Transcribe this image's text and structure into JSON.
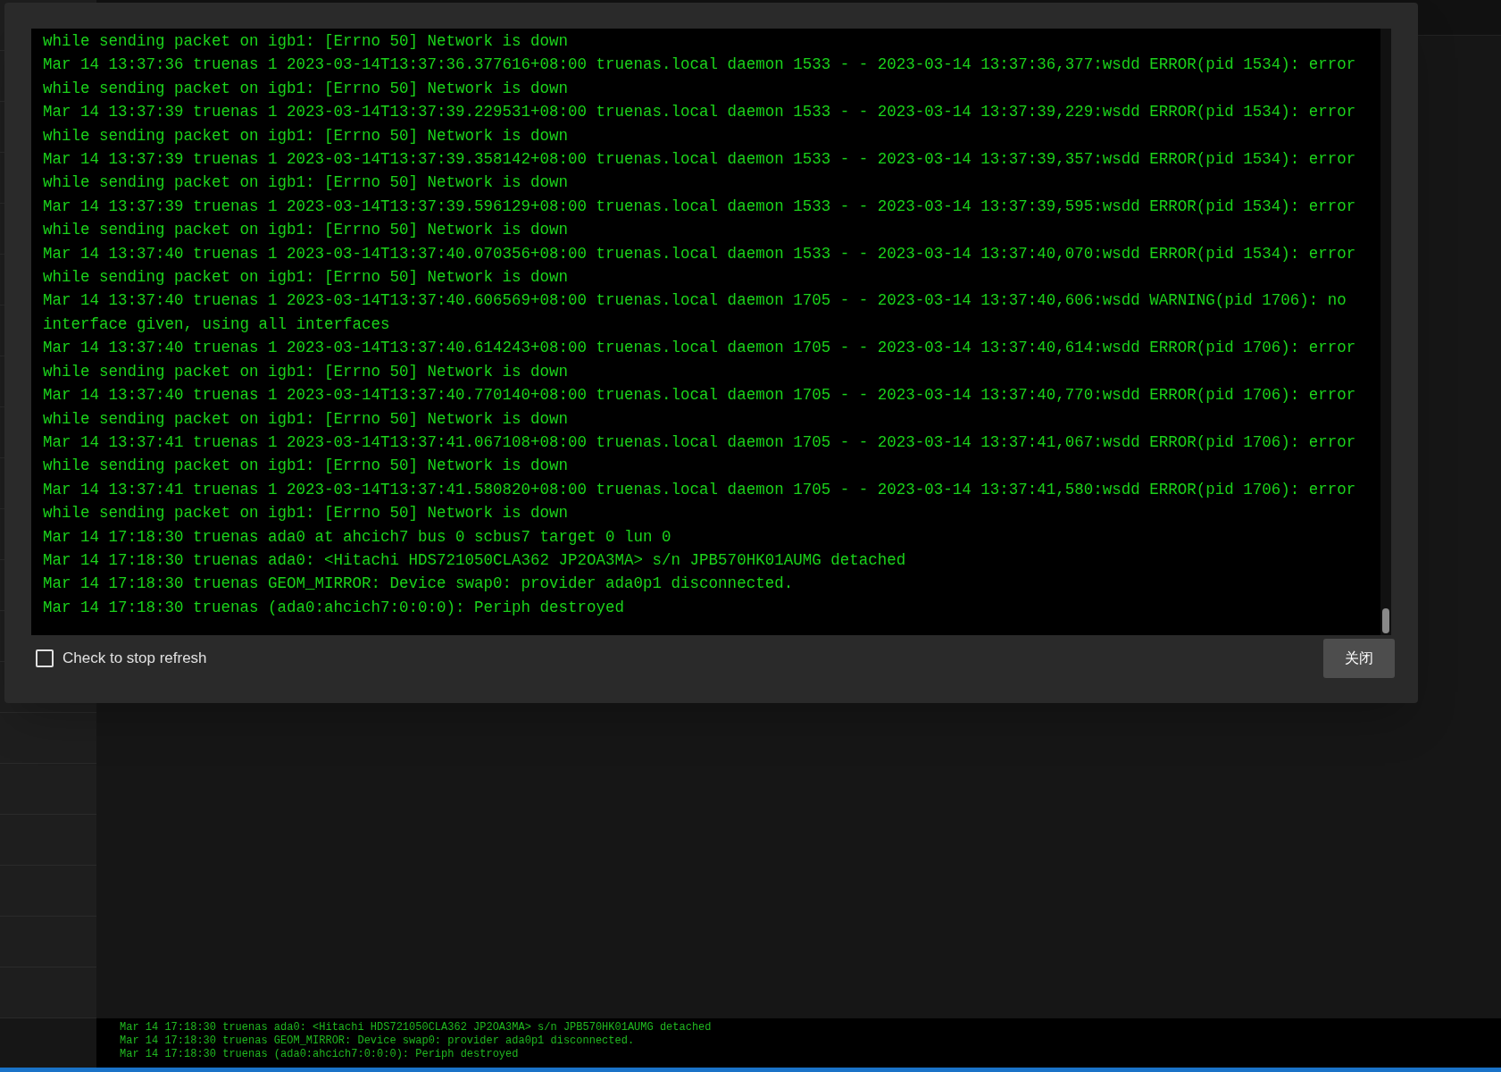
{
  "log_dialog": {
    "lines": [
      "while sending packet on igb1: [Errno 50] Network is down",
      "Mar 14 13:37:36 truenas 1 2023-03-14T13:37:36.377616+08:00 truenas.local daemon 1533 - - 2023-03-14 13:37:36,377:wsdd ERROR(pid 1534): error",
      "while sending packet on igb1: [Errno 50] Network is down",
      "Mar 14 13:37:39 truenas 1 2023-03-14T13:37:39.229531+08:00 truenas.local daemon 1533 - - 2023-03-14 13:37:39,229:wsdd ERROR(pid 1534): error",
      "while sending packet on igb1: [Errno 50] Network is down",
      "Mar 14 13:37:39 truenas 1 2023-03-14T13:37:39.358142+08:00 truenas.local daemon 1533 - - 2023-03-14 13:37:39,357:wsdd ERROR(pid 1534): error",
      "while sending packet on igb1: [Errno 50] Network is down",
      "Mar 14 13:37:39 truenas 1 2023-03-14T13:37:39.596129+08:00 truenas.local daemon 1533 - - 2023-03-14 13:37:39,595:wsdd ERROR(pid 1534): error",
      "while sending packet on igb1: [Errno 50] Network is down",
      "Mar 14 13:37:40 truenas 1 2023-03-14T13:37:40.070356+08:00 truenas.local daemon 1533 - - 2023-03-14 13:37:40,070:wsdd ERROR(pid 1534): error",
      "while sending packet on igb1: [Errno 50] Network is down",
      "Mar 14 13:37:40 truenas 1 2023-03-14T13:37:40.606569+08:00 truenas.local daemon 1705 - - 2023-03-14 13:37:40,606:wsdd WARNING(pid 1706): no",
      "interface given, using all interfaces",
      "Mar 14 13:37:40 truenas 1 2023-03-14T13:37:40.614243+08:00 truenas.local daemon 1705 - - 2023-03-14 13:37:40,614:wsdd ERROR(pid 1706): error",
      "while sending packet on igb1: [Errno 50] Network is down",
      "Mar 14 13:37:40 truenas 1 2023-03-14T13:37:40.770140+08:00 truenas.local daemon 1705 - - 2023-03-14 13:37:40,770:wsdd ERROR(pid 1706): error",
      "while sending packet on igb1: [Errno 50] Network is down",
      "Mar 14 13:37:41 truenas 1 2023-03-14T13:37:41.067108+08:00 truenas.local daemon 1705 - - 2023-03-14 13:37:41,067:wsdd ERROR(pid 1706): error",
      "while sending packet on igb1: [Errno 50] Network is down",
      "Mar 14 13:37:41 truenas 1 2023-03-14T13:37:41.580820+08:00 truenas.local daemon 1705 - - 2023-03-14 13:37:41,580:wsdd ERROR(pid 1706): error",
      "while sending packet on igb1: [Errno 50] Network is down",
      "Mar 14 17:18:30 truenas ada0 at ahcich7 bus 0 scbus7 target 0 lun 0",
      "Mar 14 17:18:30 truenas ada0: <Hitachi HDS721050CLA362 JP2OA3MA> s/n JPB570HK01AUMG detached",
      "Mar 14 17:18:30 truenas GEOM_MIRROR: Device swap0: provider ada0p1 disconnected.",
      "Mar 14 17:18:30 truenas (ada0:ahcich7:0:0:0): Periph destroyed"
    ],
    "stop_refresh": {
      "label": "Check to stop refresh",
      "checked": false
    },
    "close_button": "关闭"
  },
  "console": {
    "lines": [
      "Mar 14 17:18:30 truenas ada0: <Hitachi HDS721050CLA362 JP2OA3MA> s/n JPB570HK01AUMG detached",
      "Mar 14 17:18:30 truenas GEOM_MIRROR: Device swap0: provider ada0p1 disconnected.",
      "Mar 14 17:18:30 truenas (ada0:ahcich7:0:0:0): Periph destroyed"
    ]
  }
}
